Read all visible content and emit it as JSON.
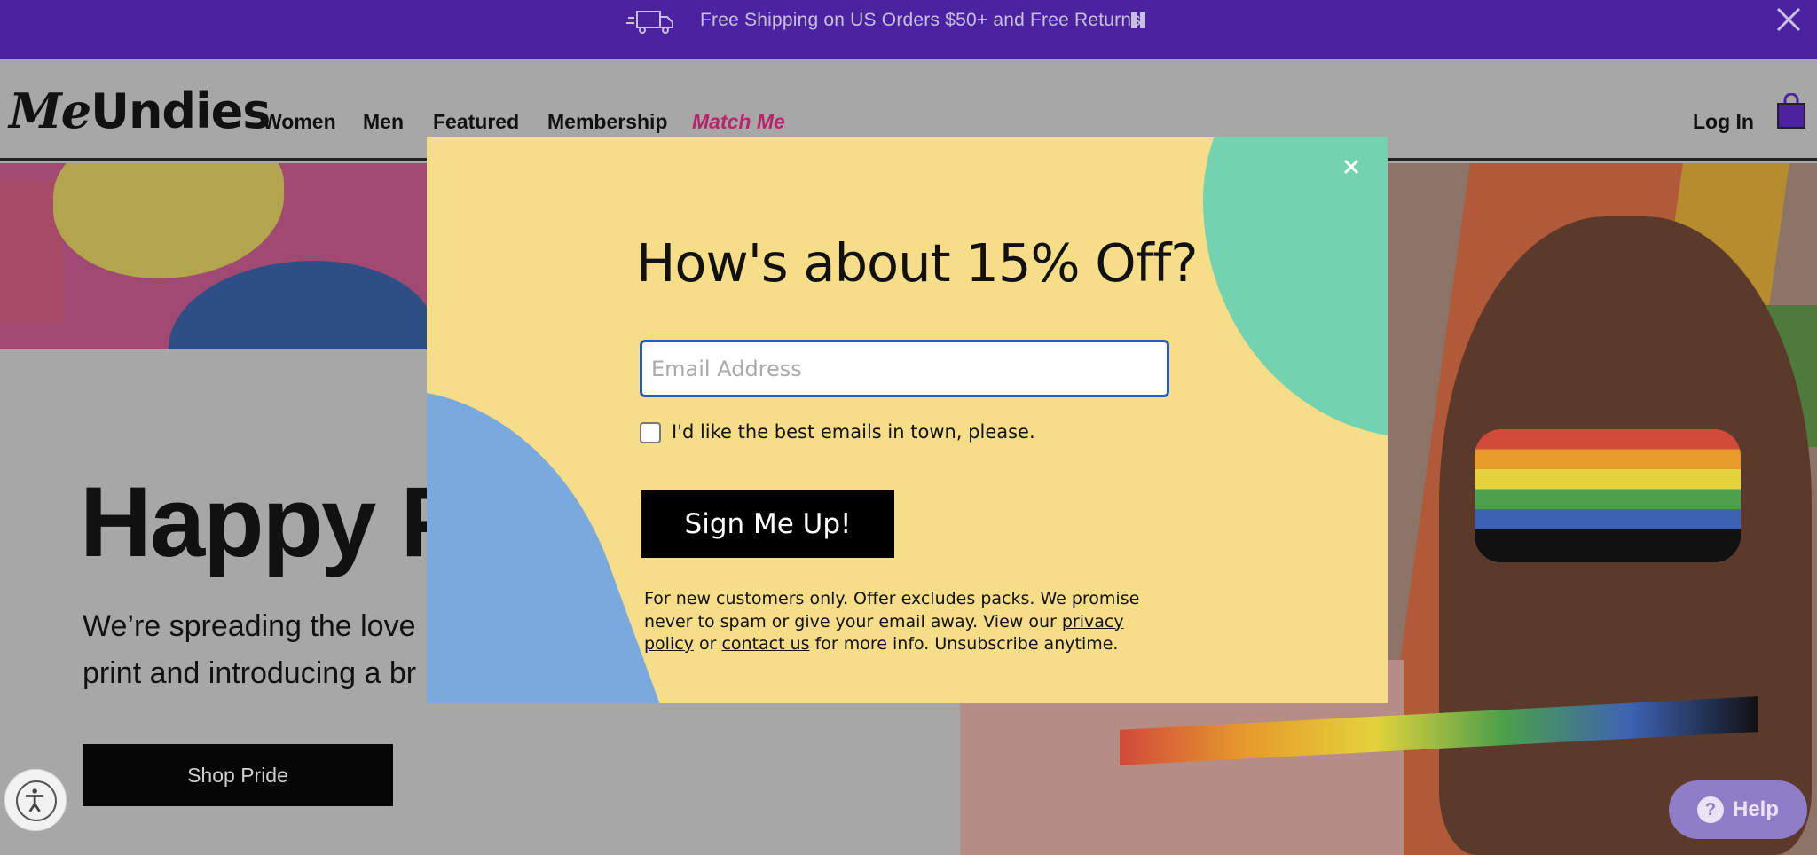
{
  "announcement": {
    "message": "Free Shipping on US Orders $50+ and Free Returns",
    "icons": [
      "truck-icon",
      "pause-icon",
      "close-icon"
    ]
  },
  "header": {
    "logo_me": "Me",
    "logo_rest": "Undies",
    "nav": [
      {
        "label": "Women"
      },
      {
        "label": "Men"
      },
      {
        "label": "Featured"
      },
      {
        "label": "Membership"
      },
      {
        "label": "Match Me"
      }
    ],
    "login": "Log In",
    "icons": [
      "bag-icon"
    ]
  },
  "hero": {
    "title": "Happy Pr",
    "subtitle_line1": "We’re spreading the love",
    "subtitle_line2": "print and introducing a br",
    "cta": "Shop Pride"
  },
  "modal": {
    "heading": "How's about 15% Off?",
    "email_placeholder": "Email Address",
    "email_value": "",
    "checkbox_label": "I'd like the best emails in town, please.",
    "checkbox_checked": false,
    "submit": "Sign Me Up!",
    "fine_print_1": "For new customers only. Offer excludes packs. We promise never to spam or give your email away. View our ",
    "privacy_link": "privacy policy",
    "fine_print_2": " or ",
    "contact_link": "contact us",
    "fine_print_3": " for more info. Unsubscribe anytime.",
    "colors": {
      "background": "#f6dd88",
      "green": "#73d3b1",
      "blue": "#7aa9e0",
      "input_border": "#2a59c9"
    }
  },
  "help": {
    "label": "Help"
  },
  "colors": {
    "announcement_bg": "#4b22a0",
    "match_me": "#b8246a",
    "help_bg": "#8f7dc7"
  }
}
